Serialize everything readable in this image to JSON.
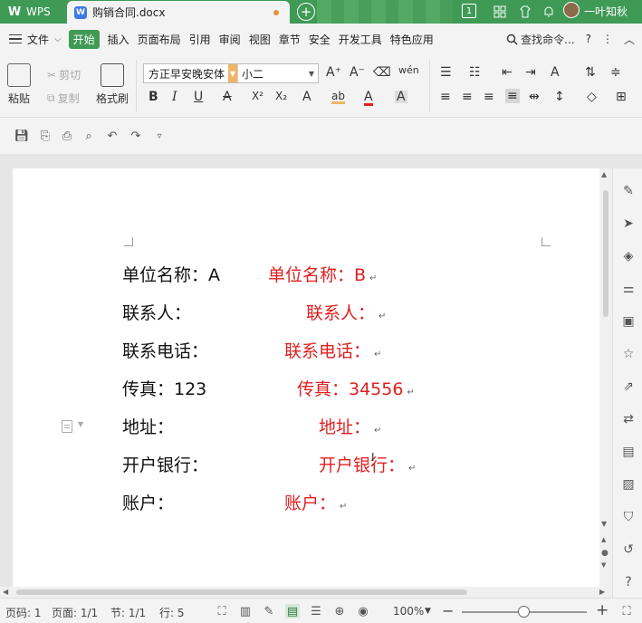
{
  "titlebar": {
    "app_name": "WPS",
    "doc_tab_title": "购销合同.docx",
    "add_tab": "+",
    "window_count": "1",
    "username": "一叶知秋"
  },
  "menubar": {
    "file_label": "文件",
    "items": [
      "开始",
      "插入",
      "页面布局",
      "引用",
      "审阅",
      "视图",
      "章节",
      "安全",
      "开发工具",
      "特色应用"
    ],
    "active_item": "开始",
    "search_label": "查找命令...",
    "help": "?"
  },
  "ribbon": {
    "paste": "粘贴",
    "cut": "剪切",
    "copy": "复制",
    "format_painter": "格式刷",
    "font_name": "方正早安晚安体",
    "font_size": "小二",
    "bold": "B",
    "italic": "I",
    "underline": "U",
    "strike": "A",
    "superscript": "X²",
    "subscript": "X₂",
    "text_effect": "A",
    "highlight": "ab",
    "font_color": "A",
    "char_shading": "A",
    "grow": "A⁺",
    "shrink": "A⁻",
    "phonetic": "wén",
    "accent_color": "#3f9a55",
    "font_dropdown_color": "#f1b468"
  },
  "document": {
    "rows": [
      {
        "left": "单位名称：A",
        "right": "单位名称：B"
      },
      {
        "left": "联系人：",
        "right": "联系人："
      },
      {
        "left": "联系电话：",
        "right": "联系电话："
      },
      {
        "left": "传真：123",
        "right": "传真：34556"
      },
      {
        "left": "地址：",
        "right": "地址："
      },
      {
        "left": "开户银行：",
        "right": "开户银行："
      },
      {
        "left": "账户：",
        "right": "账户："
      }
    ],
    "paragraph_mark": "↵",
    "left_color": "#111111",
    "right_color": "#e02020"
  },
  "statusbar": {
    "page_code": "页码: 1",
    "page": "页面: 1/1",
    "section": "节: 1/1",
    "line": "行: 5",
    "zoom": "100%",
    "zoom_minus": "−",
    "zoom_plus": "+"
  }
}
